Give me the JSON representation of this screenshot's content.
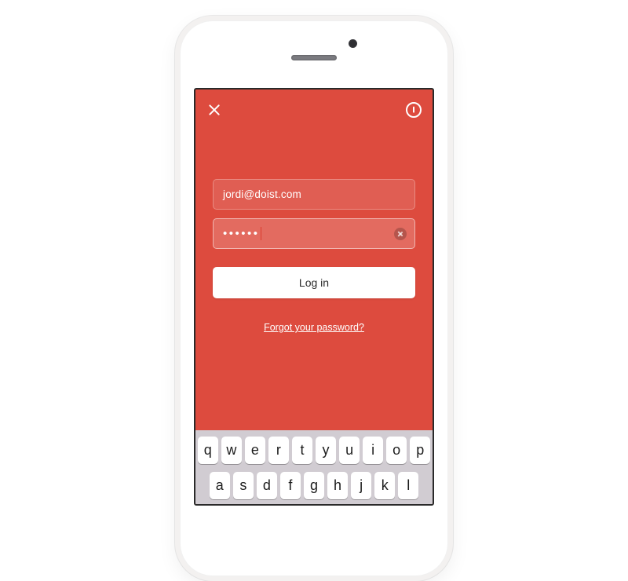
{
  "colors": {
    "accent": "#dd4b3e",
    "keyboard_bg": "#d1ccd2",
    "phone_shell": "#f3f1f0"
  },
  "header": {
    "close_icon": "close-icon",
    "autofill_icon": "onepassword-icon"
  },
  "form": {
    "email": {
      "value": "jordi@doist.com"
    },
    "password": {
      "value_masked": "••••••",
      "has_clear": true,
      "focused": true
    },
    "login_label": "Log in",
    "forgot_label": "Forgot your password?"
  },
  "keyboard": {
    "row1": [
      "q",
      "w",
      "e",
      "r",
      "t",
      "y",
      "u",
      "i",
      "o",
      "p"
    ],
    "row2": [
      "a",
      "s",
      "d",
      "f",
      "g",
      "h",
      "j",
      "k",
      "l"
    ]
  }
}
